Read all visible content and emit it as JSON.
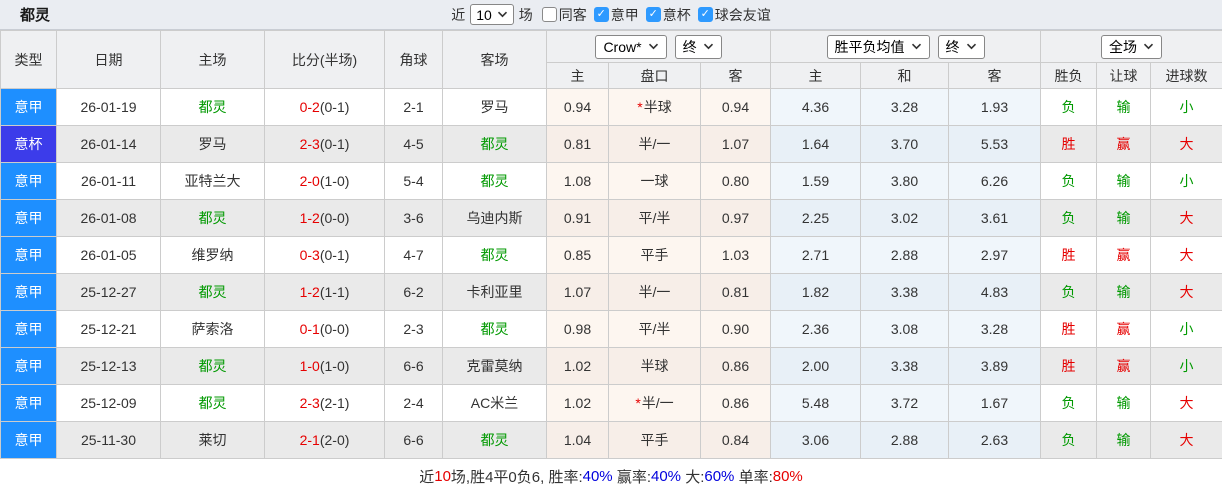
{
  "topbar": {
    "title": "都灵",
    "recent_prefix": "近",
    "recent_select": "10",
    "recent_suffix": "场",
    "check_icon": "✓",
    "filters": [
      {
        "label": "同客",
        "checked": false
      },
      {
        "label": "意甲",
        "checked": true
      },
      {
        "label": "意杯",
        "checked": true
      },
      {
        "label": "球会友谊",
        "checked": true
      }
    ]
  },
  "table": {
    "columns": [
      "类型",
      "日期",
      "主场",
      "比分(半场)",
      "角球",
      "客场"
    ],
    "selects": {
      "odds_source": "Crow*",
      "odds_stage": "终",
      "avg_source": "胜平负均值",
      "avg_stage": "终",
      "scope": "全场"
    },
    "sub_headers": [
      "主",
      "盘口",
      "客",
      "主",
      "和",
      "客",
      "胜负",
      "让球",
      "进球数"
    ],
    "star_icon": "*",
    "colors": {
      "a": "#1e8fff",
      "b": "#3c3cea"
    },
    "rows": [
      {
        "league": "意甲",
        "league_type": "a",
        "date": "26-01-19",
        "home": "都灵",
        "home_self": true,
        "score": "0-2",
        "half": "(0-1)",
        "corners": "2-1",
        "away": "罗马",
        "away_self": false,
        "star": true,
        "o_home": "0.94",
        "handicap": "半球",
        "o_away": "0.94",
        "avg_home": "4.36",
        "avg_draw": "3.28",
        "avg_away": "1.93",
        "result": "负",
        "result_c": "g",
        "handicap_r": "输",
        "handicap_c": "g",
        "goals": "小",
        "goals_c": "g"
      },
      {
        "league": "意杯",
        "league_type": "b",
        "date": "26-01-14",
        "home": "罗马",
        "home_self": false,
        "score": "2-3",
        "half": "(0-1)",
        "corners": "4-5",
        "away": "都灵",
        "away_self": true,
        "star": false,
        "o_home": "0.81",
        "handicap": "半/一",
        "o_away": "1.07",
        "avg_home": "1.64",
        "avg_draw": "3.70",
        "avg_away": "5.53",
        "result": "胜",
        "result_c": "r",
        "handicap_r": "赢",
        "handicap_c": "r",
        "goals": "大",
        "goals_c": "r"
      },
      {
        "league": "意甲",
        "league_type": "a",
        "date": "26-01-11",
        "home": "亚特兰大",
        "home_self": false,
        "score": "2-0",
        "half": "(1-0)",
        "corners": "5-4",
        "away": "都灵",
        "away_self": true,
        "star": false,
        "o_home": "1.08",
        "handicap": "一球",
        "o_away": "0.80",
        "avg_home": "1.59",
        "avg_draw": "3.80",
        "avg_away": "6.26",
        "result": "负",
        "result_c": "g",
        "handicap_r": "输",
        "handicap_c": "g",
        "goals": "小",
        "goals_c": "g"
      },
      {
        "league": "意甲",
        "league_type": "a",
        "date": "26-01-08",
        "home": "都灵",
        "home_self": true,
        "score": "1-2",
        "half": "(0-0)",
        "corners": "3-6",
        "away": "乌迪内斯",
        "away_self": false,
        "star": false,
        "o_home": "0.91",
        "handicap": "平/半",
        "o_away": "0.97",
        "avg_home": "2.25",
        "avg_draw": "3.02",
        "avg_away": "3.61",
        "result": "负",
        "result_c": "g",
        "handicap_r": "输",
        "handicap_c": "g",
        "goals": "大",
        "goals_c": "r"
      },
      {
        "league": "意甲",
        "league_type": "a",
        "date": "26-01-05",
        "home": "维罗纳",
        "home_self": false,
        "score": "0-3",
        "half": "(0-1)",
        "corners": "4-7",
        "away": "都灵",
        "away_self": true,
        "star": false,
        "o_home": "0.85",
        "handicap": "平手",
        "o_away": "1.03",
        "avg_home": "2.71",
        "avg_draw": "2.88",
        "avg_away": "2.97",
        "result": "胜",
        "result_c": "r",
        "handicap_r": "赢",
        "handicap_c": "r",
        "goals": "大",
        "goals_c": "r"
      },
      {
        "league": "意甲",
        "league_type": "a",
        "date": "25-12-27",
        "home": "都灵",
        "home_self": true,
        "score": "1-2",
        "half": "(1-1)",
        "corners": "6-2",
        "away": "卡利亚里",
        "away_self": false,
        "star": false,
        "o_home": "1.07",
        "handicap": "半/一",
        "o_away": "0.81",
        "avg_home": "1.82",
        "avg_draw": "3.38",
        "avg_away": "4.83",
        "result": "负",
        "result_c": "g",
        "handicap_r": "输",
        "handicap_c": "g",
        "goals": "大",
        "goals_c": "r"
      },
      {
        "league": "意甲",
        "league_type": "a",
        "date": "25-12-21",
        "home": "萨索洛",
        "home_self": false,
        "score": "0-1",
        "half": "(0-0)",
        "corners": "2-3",
        "away": "都灵",
        "away_self": true,
        "star": false,
        "o_home": "0.98",
        "handicap": "平/半",
        "o_away": "0.90",
        "avg_home": "2.36",
        "avg_draw": "3.08",
        "avg_away": "3.28",
        "result": "胜",
        "result_c": "r",
        "handicap_r": "赢",
        "handicap_c": "r",
        "goals": "小",
        "goals_c": "g"
      },
      {
        "league": "意甲",
        "league_type": "a",
        "date": "25-12-13",
        "home": "都灵",
        "home_self": true,
        "score": "1-0",
        "half": "(1-0)",
        "corners": "6-6",
        "away": "克雷莫纳",
        "away_self": false,
        "star": false,
        "o_home": "1.02",
        "handicap": "半球",
        "o_away": "0.86",
        "avg_home": "2.00",
        "avg_draw": "3.38",
        "avg_away": "3.89",
        "result": "胜",
        "result_c": "r",
        "handicap_r": "赢",
        "handicap_c": "r",
        "goals": "小",
        "goals_c": "g"
      },
      {
        "league": "意甲",
        "league_type": "a",
        "date": "25-12-09",
        "home": "都灵",
        "home_self": true,
        "score": "2-3",
        "half": "(2-1)",
        "corners": "2-4",
        "away": "AC米兰",
        "away_self": false,
        "star": true,
        "o_home": "1.02",
        "handicap": "半/一",
        "o_away": "0.86",
        "avg_home": "5.48",
        "avg_draw": "3.72",
        "avg_away": "1.67",
        "result": "负",
        "result_c": "g",
        "handicap_r": "输",
        "handicap_c": "g",
        "goals": "大",
        "goals_c": "r"
      },
      {
        "league": "意甲",
        "league_type": "a",
        "date": "25-11-30",
        "home": "莱切",
        "home_self": false,
        "score": "2-1",
        "half": "(2-0)",
        "corners": "6-6",
        "away": "都灵",
        "away_self": true,
        "star": false,
        "o_home": "1.04",
        "handicap": "平手",
        "o_away": "0.84",
        "avg_home": "3.06",
        "avg_draw": "2.88",
        "avg_away": "2.63",
        "result": "负",
        "result_c": "g",
        "handicap_r": "输",
        "handicap_c": "g",
        "goals": "大",
        "goals_c": "r"
      }
    ]
  },
  "summary": {
    "segments": [
      {
        "text": "近",
        "color": "dark"
      },
      {
        "text": "10",
        "color": "red"
      },
      {
        "text": "场,胜4平0负6, 胜率:",
        "color": "dark"
      },
      {
        "text": "40%",
        "color": "blue"
      },
      {
        "text": " 赢率:",
        "color": "dark"
      },
      {
        "text": "40%",
        "color": "blue"
      },
      {
        "text": " 大:",
        "color": "dark"
      },
      {
        "text": "60%",
        "color": "blue"
      },
      {
        "text": " 单率:",
        "color": "dark"
      },
      {
        "text": "80%",
        "color": "red"
      }
    ]
  }
}
